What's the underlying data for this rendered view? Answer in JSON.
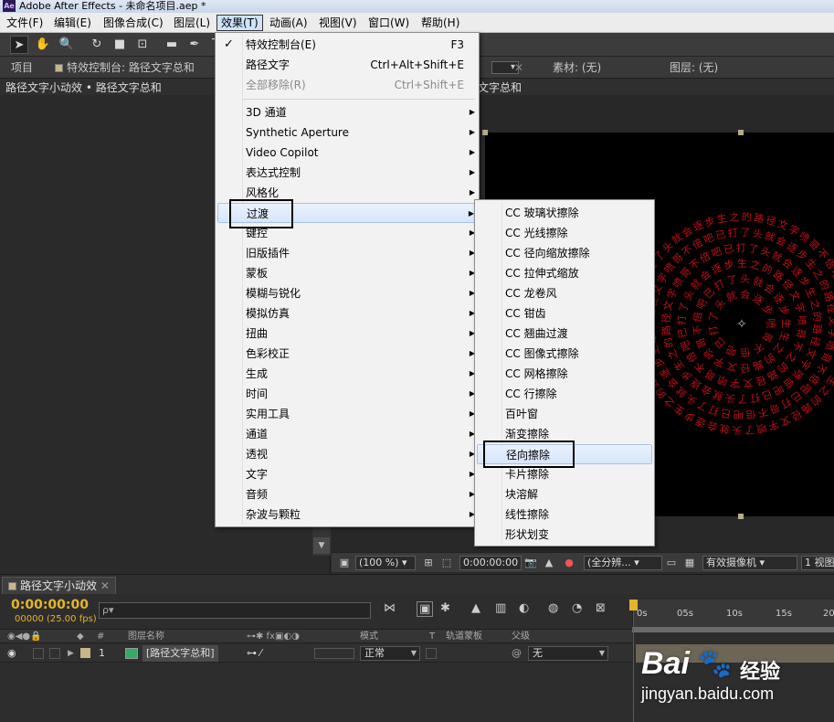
{
  "window": {
    "title": "Adobe After Effects - 未命名项目.aep *",
    "logo": "Ae"
  },
  "menubar": [
    {
      "label": "文件(F)"
    },
    {
      "label": "编辑(E)"
    },
    {
      "label": "图像合成(C)"
    },
    {
      "label": "图层(L)"
    },
    {
      "label": "效果(T)"
    },
    {
      "label": "动画(A)"
    },
    {
      "label": "视图(V)"
    },
    {
      "label": "窗口(W)"
    },
    {
      "label": "帮助(H)"
    }
  ],
  "toolbar": {
    "icons": [
      "selection-tool-icon",
      "hand-tool-icon",
      "zoom-tool-icon",
      "rotate-tool-icon",
      "camera-tool-icon",
      "pan-behind-tool-icon",
      "rectangle-tool-icon",
      "pen-tool-icon",
      "text-tool-icon"
    ]
  },
  "panels": {
    "project_tab": "项目",
    "effect_controls_tab": "特效控制台: 路径文字总和",
    "breadcrumb": "路径文字小动效 • 路径文字总和",
    "footage_tab": "素材: (无)",
    "layer_tab": "图层: (无)",
    "comp_breadcrumb": "文字总和"
  },
  "effect_menu": {
    "check": "✓",
    "items": [
      {
        "label": "特效控制台(E)",
        "shortcut": "F3"
      },
      {
        "label": "路径文字",
        "shortcut": "Ctrl+Alt+Shift+E"
      },
      {
        "label": "全部移除(R)",
        "shortcut": "Ctrl+Shift+E"
      }
    ],
    "categories": [
      "3D 通道",
      "Synthetic Aperture",
      "Video Copilot",
      "表达式控制",
      "风格化",
      "过渡",
      "键控",
      "旧版插件",
      "蒙板",
      "模糊与锐化",
      "模拟仿真",
      "扭曲",
      "色彩校正",
      "生成",
      "时间",
      "实用工具",
      "通道",
      "透视",
      "文字",
      "音频",
      "杂波与颗粒"
    ],
    "submenu_arrow": "▶"
  },
  "transition_submenu": {
    "items": [
      "CC 玻璃状擦除",
      "CC 光线擦除",
      "CC 径向缩放擦除",
      "CC 拉伸式缩放",
      "CC 龙卷风",
      "CC 钳齿",
      "CC 翘曲过渡",
      "CC 图像式擦除",
      "CC 网格擦除",
      "CC 行擦除",
      "百叶窗",
      "渐变擦除",
      "径向擦除",
      "卡片擦除",
      "块溶解",
      "线性擦除",
      "形状划变"
    ],
    "highlighted": "径向擦除"
  },
  "viewer": {
    "zoom": "(100 %)",
    "timecode": "0:00:00:00",
    "resolution": "(全分辨...",
    "camera": "有效摄像机",
    "views": "1 视图"
  },
  "canvas": {
    "spiral_text": "喷哥不倍吧已打了头就会逐步生之的路径文字",
    "color": "#c0101a"
  },
  "timeline": {
    "tab": "路径文字小动效",
    "timecode": "0:00:00:00",
    "fps": "00000 (25.00 fps)",
    "search_placeholder": "ρ▾",
    "columns": {
      "name": "图层名称",
      "mode": "模式",
      "t": "T",
      "trkmat": "轨道蒙板",
      "parent": "父级",
      "num": "#"
    },
    "layer": {
      "index": "1",
      "name": "[路径文字总和]",
      "mode": "正常",
      "parent": "无"
    },
    "ruler": [
      "0s",
      "05s",
      "10s",
      "15s",
      "20s"
    ]
  },
  "watermark": {
    "brand": "Bai",
    "brand2": "经验",
    "url": "jingyan.baidu.com"
  }
}
